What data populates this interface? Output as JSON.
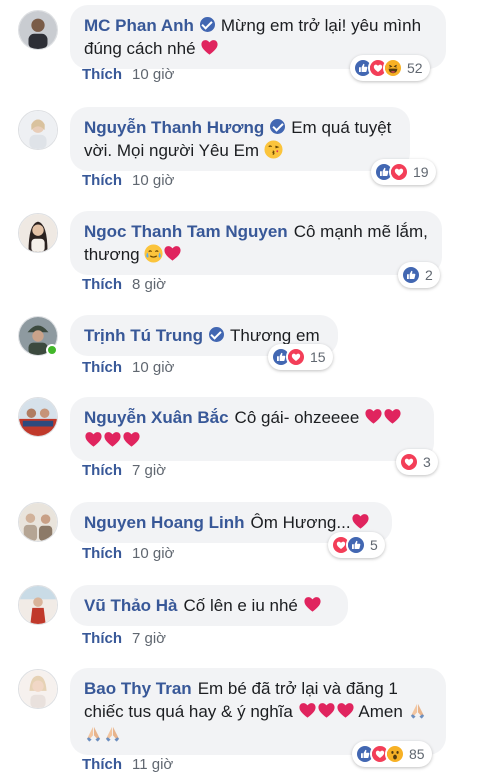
{
  "comments": [
    {
      "name": "MC Phan Anh",
      "verified": true,
      "text": "Mừng em trở lại! yêu mình đúng cách nhé",
      "like_label": "Thích",
      "time": "10 giờ",
      "reactions": [
        "like",
        "love",
        "haha"
      ],
      "count": "52"
    },
    {
      "name": "Nguyễn Thanh Hương",
      "verified": true,
      "text": "Em quá tuyệt vời. Mọi người Yêu Em",
      "like_label": "Thích",
      "time": "10 giờ",
      "reactions": [
        "like",
        "love"
      ],
      "count": "19"
    },
    {
      "name": "Ngoc Thanh Tam Nguyen",
      "verified": false,
      "text": "Cô mạnh mẽ lắm, thương",
      "like_label": "Thích",
      "time": "8 giờ",
      "reactions": [
        "like"
      ],
      "count": "2"
    },
    {
      "name": "Trịnh Tú Trung",
      "verified": true,
      "text": "Thương em",
      "like_label": "Thích",
      "time": "10 giờ",
      "reactions": [
        "like",
        "love"
      ],
      "count": "15"
    },
    {
      "name": "Nguyễn Xuân Bắc",
      "verified": false,
      "text": "Cô gái- ohzeeee",
      "like_label": "Thích",
      "time": "7 giờ",
      "reactions": [
        "love"
      ],
      "count": "3"
    },
    {
      "name": "Nguyen Hoang Linh",
      "verified": false,
      "text": "Ôm Hương...",
      "like_label": "Thích",
      "time": "10 giờ",
      "reactions": [
        "love",
        "like"
      ],
      "count": "5"
    },
    {
      "name": "Vũ Thảo Hà",
      "verified": false,
      "text": "Cố lên e iu nhé",
      "like_label": "Thích",
      "time": "7 giờ",
      "reactions": [],
      "count": ""
    },
    {
      "name": "Bao Thy Tran",
      "verified": false,
      "text": "Em bé đã trở lại và đăng 1 chiếc tus quá hay & ý nghĩa",
      "text2": "Amen",
      "like_label": "Thích",
      "time": "11 giờ",
      "reactions": [
        "like",
        "love",
        "wow"
      ],
      "count": "85"
    }
  ],
  "colors": {
    "link": "#385898",
    "bubble": "#f2f3f5",
    "like": "#4267b2",
    "love": "#f33e58",
    "haha": "#f7b125",
    "online": "#42b72a"
  }
}
